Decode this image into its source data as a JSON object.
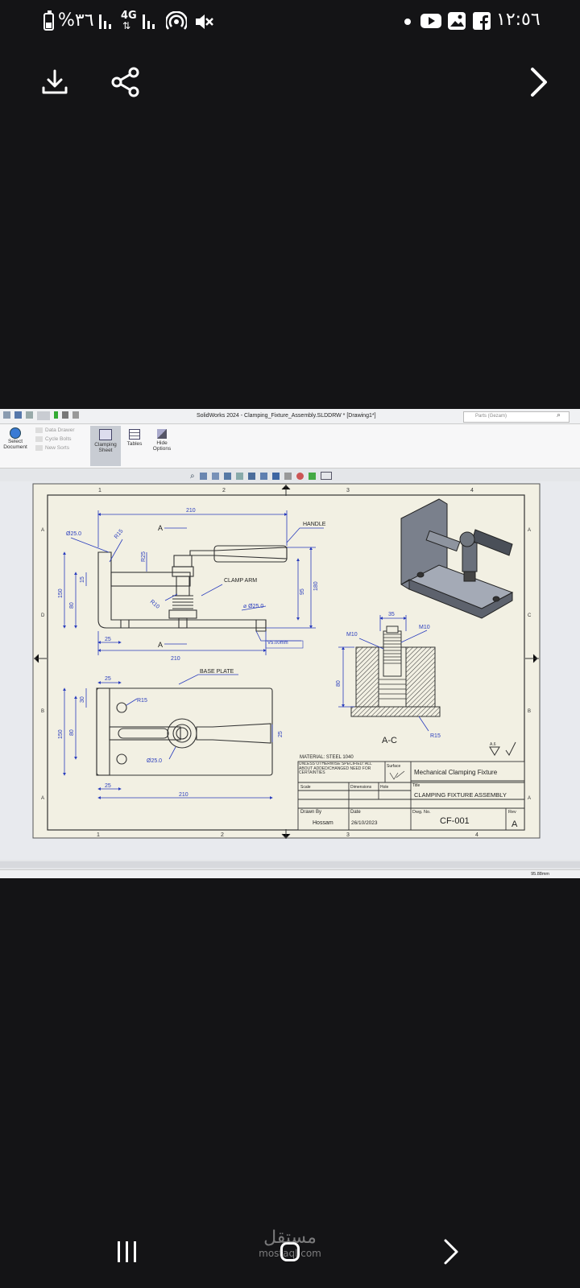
{
  "status_bar": {
    "battery_text": "%٣٦",
    "network_label": "4G",
    "time": "١٢:٥٦"
  },
  "viewer_toolbar": {
    "download_icon": "download-icon",
    "share_icon": "share-icon",
    "next_icon": "chevron-right-icon"
  },
  "solidworks": {
    "window_title": "SolidWorks 2024 - Clamping_Fixture_Assembly.SLDDRW * [Drawing1*]",
    "search_placeholder": "Parts (Gezam)",
    "ribbon": {
      "select_document": "Select Document",
      "data_drawer": "Data Drawer",
      "cycle_bolts": "Cycle Bolts",
      "new_sorts": "New Sorts",
      "clamping_sheet": "Clamping Sheet",
      "tables": "Tables",
      "hide_options": "Hide Options"
    },
    "status_zoom": "95.88mm"
  },
  "drawing": {
    "col_markers": [
      "1",
      "2",
      "3",
      "4"
    ],
    "row_markers_left": [
      "A",
      "D",
      "B",
      "A"
    ],
    "row_markers_right": [
      "A",
      "C",
      "B",
      "A"
    ],
    "labels": {
      "handle": "HANDLE",
      "clamp_arm": "CLAMP ARM",
      "base_plate": "BASE PLATE",
      "section_a": "A",
      "section_ac": "A-C",
      "material": "MATERIAL: STEEL 1040"
    },
    "dims": {
      "top_210": "210",
      "bottom_210": "210",
      "plan_210": "210",
      "d25": "Ø25.0",
      "r15": "R15",
      "r25": "R25",
      "r10": "R10",
      "h150": "150",
      "h80": "80",
      "h15": "15",
      "h180": "180",
      "h95": "95",
      "d25_arm": "⌀ Ø25.0",
      "w25": "25",
      "v95": "V5.00mm",
      "p25": "25",
      "p30": "30",
      "p150": "150",
      "p80": "80",
      "pr15": "R15",
      "pd25": "Ø25.0",
      "p25b": "25",
      "p25c": "25",
      "s35": "35",
      "m10a": "M10",
      "m10b": "M10",
      "s80": "80",
      "sr15": "R15"
    },
    "title_block": {
      "general_note": "UNLESS OTHERWISE SPECIFIED: ALL ABOUT ADDED/CHANGED NEED FOR CERTAINTIES",
      "surface_label": "Surface",
      "company": "Mechanical Clamping Fixture",
      "scale_label": "Scale",
      "drawn_label": "Dimensions",
      "approved_label": "Hole",
      "title_label": "Title",
      "title": "CLAMPING FIXTURE ASSEMBLY",
      "drawn_by_label": "Drawn By",
      "drawn_by": "Hossam",
      "date_label": "Date",
      "date": "26/10/2023",
      "dwg_no_label": "Dwg. No.",
      "dwg_no": "CF-001",
      "rev_label": "Rev",
      "rev": "A",
      "finish_mark": "A.6"
    }
  },
  "nav_bar": {
    "recents_icon": "recents-icon",
    "home_icon": "home-icon",
    "back_icon": "back-chevron-icon",
    "watermark_ar": "مستقل",
    "watermark_en": "mostaql.com"
  }
}
